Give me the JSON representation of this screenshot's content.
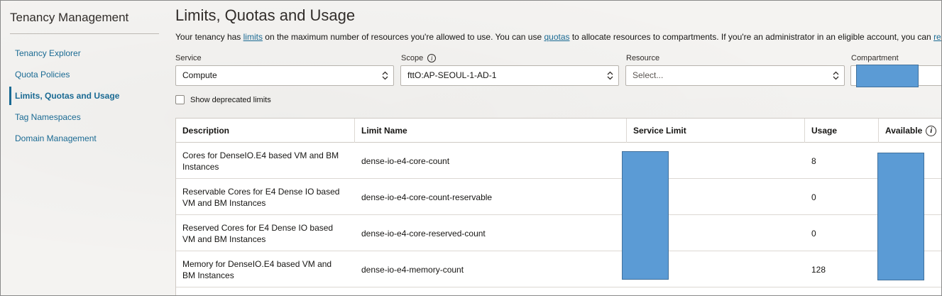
{
  "sidebar": {
    "title": "Tenancy Management",
    "items": [
      {
        "label": "Tenancy Explorer",
        "active": false
      },
      {
        "label": "Quota Policies",
        "active": false
      },
      {
        "label": "Limits, Quotas and Usage",
        "active": true
      },
      {
        "label": "Tag Namespaces",
        "active": false
      },
      {
        "label": "Domain Management",
        "active": false
      }
    ]
  },
  "main": {
    "title": "Limits, Quotas and Usage",
    "intro": {
      "part1": "Your tenancy has ",
      "link1": "limits",
      "part2": " on the maximum number of resources you're allowed to use. You can use ",
      "link2": "quotas",
      "part3": " to allocate resources to compartments. If you're an administrator in an eligible account, you can ",
      "link3": "request"
    }
  },
  "filters": {
    "service": {
      "label": "Service",
      "value": "Compute"
    },
    "scope": {
      "label": "Scope",
      "value": "fttO:AP-SEOUL-1-AD-1"
    },
    "resource": {
      "label": "Resource",
      "placeholder": "Select..."
    },
    "compartment": {
      "label": "Compartment"
    }
  },
  "show_deprecated": {
    "label": "Show deprecated limits",
    "checked": false
  },
  "table": {
    "headers": {
      "description": "Description",
      "limit_name": "Limit Name",
      "service_limit": "Service Limit",
      "usage": "Usage",
      "available": "Available"
    },
    "rows": [
      {
        "description": "Cores for DenseIO.E4 based VM and BM Instances",
        "limit_name": "dense-io-e4-core-count",
        "usage": "8"
      },
      {
        "description": "Reservable Cores for E4 Dense IO based VM and BM Instances",
        "limit_name": "dense-io-e4-core-count-reservable",
        "usage": "0"
      },
      {
        "description": "Reserved Cores for E4 Dense IO based VM and BM Instances",
        "limit_name": "dense-io-e4-core-reserved-count",
        "usage": "0"
      },
      {
        "description": "Memory for DenseIO.E4 based VM and BM Instances",
        "limit_name": "dense-io-e4-memory-count",
        "usage": "128"
      }
    ]
  },
  "colors": {
    "link": "#1a6a93",
    "redaction": "#5b9bd5"
  }
}
